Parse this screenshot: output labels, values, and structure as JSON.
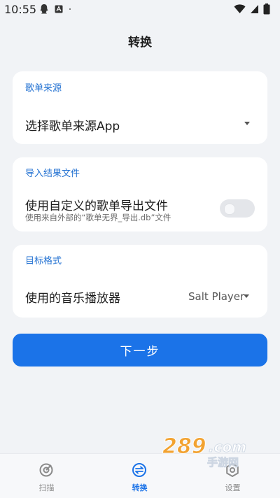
{
  "status_bar": {
    "time": "10:55"
  },
  "header": {
    "title": "转换"
  },
  "source_card": {
    "header": "歌单来源",
    "select_label": "选择歌单来源App"
  },
  "import_card": {
    "header": "导入结果文件",
    "option_title": "使用自定义的歌单导出文件",
    "option_desc": "使用来自外部的“歌单无界_导出.db”文件",
    "toggle_on": false
  },
  "target_card": {
    "header": "目标格式",
    "player_label": "使用的音乐播放器",
    "player_value": "Salt Player"
  },
  "next_button": {
    "label": "下一步"
  },
  "bottom_nav": {
    "items": [
      {
        "label": "扫描",
        "icon": "scan-icon"
      },
      {
        "label": "转换",
        "icon": "convert-icon",
        "active": true
      },
      {
        "label": "设置",
        "icon": "settings-icon"
      }
    ]
  },
  "watermark": {
    "text": "289.com 手游网"
  },
  "colors": {
    "accent": "#1b73e8",
    "background": "#f1f3f6",
    "card": "#ffffff"
  }
}
